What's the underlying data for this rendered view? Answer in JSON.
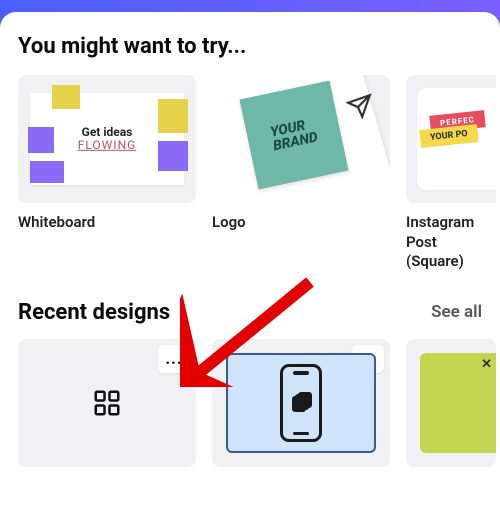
{
  "sections": {
    "suggestions_title": "You might want to try...",
    "recent_title": "Recent designs",
    "see_all": "See all"
  },
  "templates": [
    {
      "label": "Whiteboard",
      "art": {
        "line1": "Get ideas",
        "line2": "FLOWING"
      }
    },
    {
      "label": "Logo",
      "art": {
        "line1": "YOUR",
        "line2": "BRAND"
      }
    },
    {
      "label": "Instagram Post (Square)",
      "art": {
        "band1": "PERFEC",
        "band2": "YOUR PO"
      }
    }
  ],
  "recent": [
    {
      "kind": "grid",
      "more": "..."
    },
    {
      "kind": "phone",
      "more": "..."
    },
    {
      "kind": "green",
      "close": "✕"
    }
  ]
}
